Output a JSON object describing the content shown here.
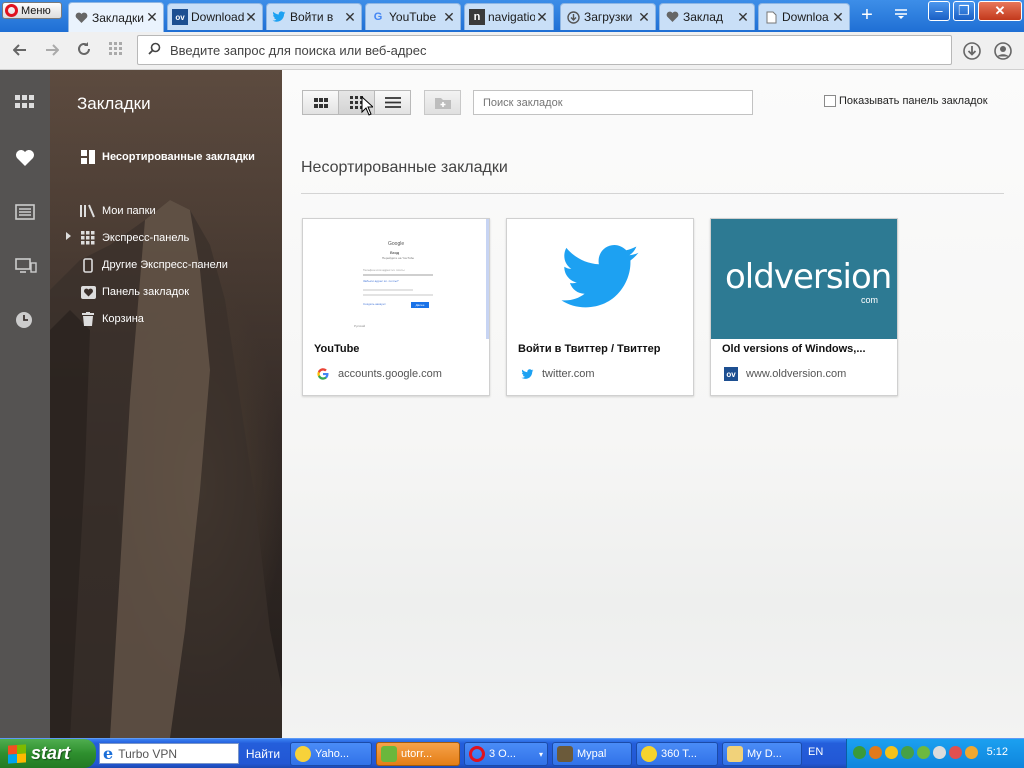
{
  "browser": {
    "menu_label": "Меню",
    "tabs": [
      {
        "title": "Закладки",
        "icon": "heart-icon",
        "active": true
      },
      {
        "title": "Download",
        "icon": "oldversion-favicon"
      },
      {
        "title": "Войти в",
        "icon": "twitter-favicon"
      },
      {
        "title": "YouTube",
        "icon": "google-favicon"
      },
      {
        "title": "navigatio",
        "icon": "n-favicon"
      },
      {
        "title": "Загрузки",
        "icon": "download-icon"
      },
      {
        "title": "Заклад",
        "icon": "heart-icon"
      },
      {
        "title": "Downloa",
        "icon": "page-icon"
      }
    ],
    "new_tab": "+",
    "address_placeholder": "Введите запрос для поиска или веб-адрес"
  },
  "sidebar": {
    "panel_title": "Закладки",
    "items": [
      {
        "label": "Несортированные закладки",
        "icon": "grid-folder-icon",
        "bold": true
      },
      {
        "label": "Мои папки",
        "icon": "folders-icon"
      },
      {
        "label": "Экспресс-панель",
        "icon": "speed-dial-icon"
      },
      {
        "label": "Другие Экспресс-панели",
        "icon": "phone-icon"
      },
      {
        "label": "Панель закладок",
        "icon": "heart-bar-icon"
      },
      {
        "label": "Корзина",
        "icon": "trash-icon"
      }
    ]
  },
  "main": {
    "search_placeholder": "Поиск закладок",
    "show_bar_label": "Показывать панель закладок",
    "show_bar_checked": false,
    "section_title": "Несортированные закладки",
    "cards": [
      {
        "title": "YouTube",
        "url": "accounts.google.com",
        "favicon": "google-favicon",
        "thumb": {
          "logo": "Google",
          "heading": "Вход",
          "sub": "Перейдите на YouTube",
          "field1": "Телефон или адрес эл. почты",
          "link1": "Забыли адрес эл. почты?",
          "link2": "Создать аккаунт",
          "button": "Далее",
          "lang": "Русский"
        }
      },
      {
        "title": "Войти в Твиттер / Твиттер",
        "url": "twitter.com",
        "favicon": "twitter-favicon"
      },
      {
        "title": "Old versions of Windows,...",
        "url": "www.oldversion.com",
        "favicon": "oldversion-favicon",
        "thumb": {
          "logo": "oldversion",
          "sub": "com"
        }
      }
    ]
  },
  "taskbar": {
    "start_label": "start",
    "address_value": "Turbo VPN",
    "find_label": "Найти",
    "tasks": [
      {
        "label": "Yaho..."
      },
      {
        "label": "utorr..."
      },
      {
        "label": "3 O..."
      },
      {
        "label": "Mypal"
      },
      {
        "label": "360 T..."
      },
      {
        "label": "My D..."
      }
    ],
    "lang": "EN",
    "clock": "5:12"
  },
  "colors": {
    "opera_red": "#e0121f",
    "twitter_blue": "#1da1f2",
    "oldversion_teal": "#2d7a93",
    "xp_blue": "#245edb",
    "xp_green": "#2e8f2e"
  }
}
